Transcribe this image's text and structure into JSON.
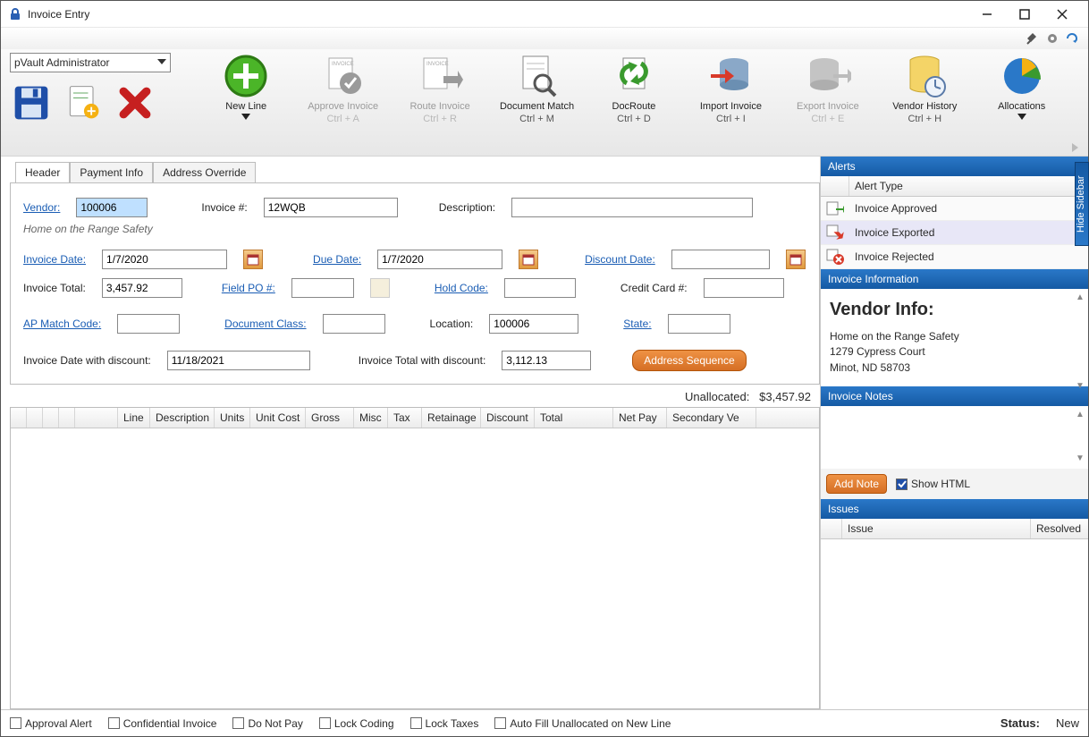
{
  "window": {
    "title": "Invoice Entry"
  },
  "user_select": {
    "value": "pVault Administrator"
  },
  "toolbar": [
    {
      "name": "new-line",
      "label": "New Line",
      "shortcut": "",
      "disabled": false,
      "dropdown": true
    },
    {
      "name": "approve-invoice",
      "label": "Approve Invoice",
      "shortcut": "Ctrl + A",
      "disabled": true,
      "dropdown": false
    },
    {
      "name": "route-invoice",
      "label": "Route Invoice",
      "shortcut": "Ctrl + R",
      "disabled": true,
      "dropdown": false
    },
    {
      "name": "document-match",
      "label": "Document Match",
      "shortcut": "Ctrl + M",
      "disabled": false,
      "dropdown": false
    },
    {
      "name": "docroute",
      "label": "DocRoute",
      "shortcut": "Ctrl + D",
      "disabled": false,
      "dropdown": false
    },
    {
      "name": "import-invoice",
      "label": "Import Invoice",
      "shortcut": "Ctrl + I",
      "disabled": false,
      "dropdown": false
    },
    {
      "name": "export-invoice",
      "label": "Export Invoice",
      "shortcut": "Ctrl + E",
      "disabled": true,
      "dropdown": false
    },
    {
      "name": "vendor-history",
      "label": "Vendor History",
      "shortcut": "Ctrl + H",
      "disabled": false,
      "dropdown": false
    },
    {
      "name": "allocations",
      "label": "Allocations",
      "shortcut": "",
      "disabled": false,
      "dropdown": true
    }
  ],
  "tabs": {
    "items": [
      "Header",
      "Payment Info",
      "Address Override"
    ],
    "active": 0
  },
  "header": {
    "vendor_label": "Vendor:",
    "vendor": "100006",
    "vendor_name": "Home on the Range Safety",
    "invoice_num_label": "Invoice #:",
    "invoice_num": "12WQB",
    "description_label": "Description:",
    "description": "",
    "invoice_date_label": "Invoice Date:",
    "invoice_date": "1/7/2020",
    "due_date_label": "Due Date:",
    "due_date": "1/7/2020",
    "discount_date_label": "Discount Date:",
    "discount_date": "",
    "invoice_total_label": "Invoice Total:",
    "invoice_total": "3,457.92",
    "field_po_label": "Field PO #:",
    "field_po": "",
    "hold_code_label": "Hold Code:",
    "hold_code": "",
    "credit_card_label": "Credit Card #:",
    "credit_card": "",
    "ap_match_label": "AP Match Code:",
    "ap_match": "",
    "doc_class_label": "Document Class:",
    "doc_class": "",
    "location_label": "Location:",
    "location": "100006",
    "state_label": "State:",
    "state": "",
    "inv_date_disc_label": "Invoice Date with discount:",
    "inv_date_disc": "11/18/2021",
    "inv_total_disc_label": "Invoice Total with discount:",
    "inv_total_disc": "3,112.13",
    "address_seq_btn": "Address Sequence"
  },
  "unallocated": {
    "label": "Unallocated:",
    "value": "$3,457.92"
  },
  "grid_cols": [
    "",
    "",
    "",
    "",
    "",
    "Line",
    "Description",
    "Units",
    "Unit Cost",
    "Gross",
    "Misc",
    "Tax",
    "Retainage",
    "Discount",
    "Total",
    "Net Pay",
    "Secondary Ve"
  ],
  "sidebar": {
    "alerts_title": "Alerts",
    "alert_type_col": "Alert Type",
    "alerts": [
      {
        "icon": "approved",
        "text": "Invoice Approved"
      },
      {
        "icon": "exported",
        "text": "Invoice Exported"
      },
      {
        "icon": "rejected",
        "text": "Invoice Rejected"
      }
    ],
    "info_title": "Invoice Information",
    "vendor_heading": "Vendor Info:",
    "vendor_lines": [
      "Home on the Range Safety",
      "1279 Cypress Court",
      "Minot, ND 58703"
    ],
    "notes_title": "Invoice Notes",
    "add_note_btn": "Add Note",
    "show_html_label": "Show HTML",
    "issues_title": "Issues",
    "issues_cols": {
      "issue": "Issue",
      "resolved": "Resolved"
    },
    "hide_label": "Hide Sidebar"
  },
  "footer": {
    "checks": [
      "Approval Alert",
      "Confidential Invoice",
      "Do Not Pay",
      "Lock Coding",
      "Lock Taxes",
      "Auto Fill Unallocated on New Line"
    ],
    "status_label": "Status:",
    "status_value": "New"
  }
}
